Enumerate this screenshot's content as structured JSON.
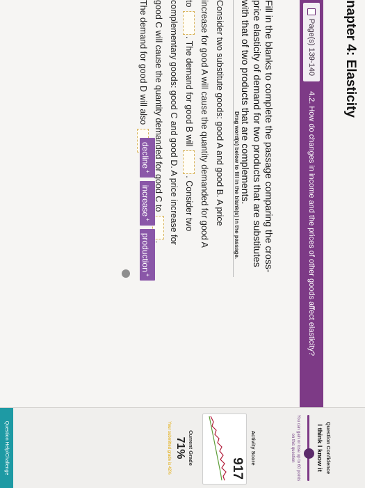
{
  "chapter": {
    "title": "napter 4: Elasticity"
  },
  "header_bar": {
    "pages_label": "Page(s) 139-140",
    "section_text": "4.2. How do changes in income and the prices of other goods affect elasticity?"
  },
  "instruction": "Fill in the blanks to complete the passage comparing the cross-price elasticity of demand for two products that are substitutes with that of two products that are complements.",
  "drag_hint": "Drag word(s) below to fill in the blank(s) in the passage.",
  "passage": {
    "s1": "Consider two substitute goods: good A and good B. A price increase for good A will cause the quantity demanded for good A to",
    "s2": ". The demand for good B will",
    "s3": ". Consider two complementary goods: good C and good D. A price increase for good C will cause the quantity demanded for good C to",
    "s4": ". The demand for good D will also",
    "s5": "."
  },
  "word_chips": [
    {
      "label": "decline",
      "marker": "+"
    },
    {
      "label": "increase",
      "marker": "+"
    },
    {
      "label": "production",
      "marker": "+"
    }
  ],
  "sidebar": {
    "question_confidence_title": "Question Confidence",
    "question_confidence_value": "I think I know it",
    "confidence_note": "You can gain or lose up to 60 points on this question",
    "activity_score_title": "Activity Score",
    "activity_score": "917",
    "current_grade_title": "Current Grade",
    "current_grade": "71%",
    "grade_note": "Your submitted grade is 42%",
    "help_label": "Question Help/Challenge"
  },
  "colors": {
    "brand_purple": "#7d3a86",
    "chip_purple": "#8a57a8",
    "help_teal": "#1e9aa4",
    "blank_border": "#d8b45c"
  }
}
